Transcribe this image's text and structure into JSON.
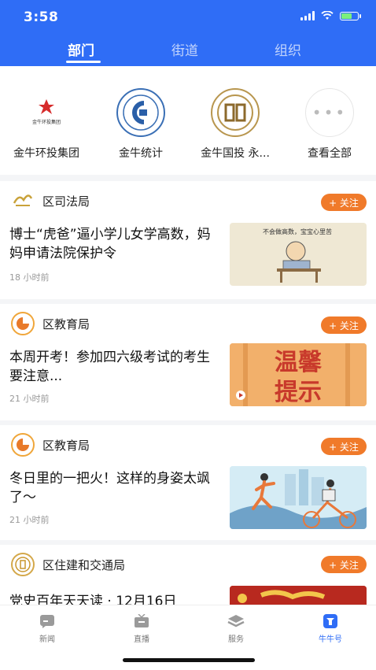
{
  "status_bar": {
    "time": "3:58"
  },
  "top_tabs": [
    {
      "label": "部门"
    },
    {
      "label": "街道"
    },
    {
      "label": "组织"
    }
  ],
  "orgs": [
    {
      "name": "金牛环投集团",
      "logo_text": "金牛环投集团"
    },
    {
      "name": "金牛统计"
    },
    {
      "name": "金牛国投 永..."
    },
    {
      "name": "查看全部"
    }
  ],
  "feed": [
    {
      "source": "区司法局",
      "follow": "+ 关注",
      "headline": "博士“虎爸”逼小学儿女学高数，妈妈申请法院保护令",
      "ago": "18 小时前",
      "thumb_text": "不会做高数，宝宝心里苦"
    },
    {
      "source": "区教育局",
      "follow": "+ 关注",
      "headline": "本周开考！参加四六级考试的考生要注意...",
      "ago": "21 小时前",
      "thumb_text_1": "温馨",
      "thumb_text_2": "提示"
    },
    {
      "source": "区教育局",
      "follow": "+ 关注",
      "headline": "冬日里的一把火！这样的身姿太飒了～",
      "ago": "21 小时前"
    },
    {
      "source": "区住建和交通局",
      "follow": "+ 关注",
      "headline": "党史百年天天读 · 12月16日"
    }
  ],
  "tabbar": [
    {
      "label": "新闻",
      "icon": "news-icon"
    },
    {
      "label": "直播",
      "icon": "tv-icon"
    },
    {
      "label": "服务",
      "icon": "service-icon"
    },
    {
      "label": "牛牛号",
      "icon": "niuniu-icon"
    }
  ],
  "colors": {
    "brand": "#2f6df6",
    "follow": "#f07a2a"
  }
}
